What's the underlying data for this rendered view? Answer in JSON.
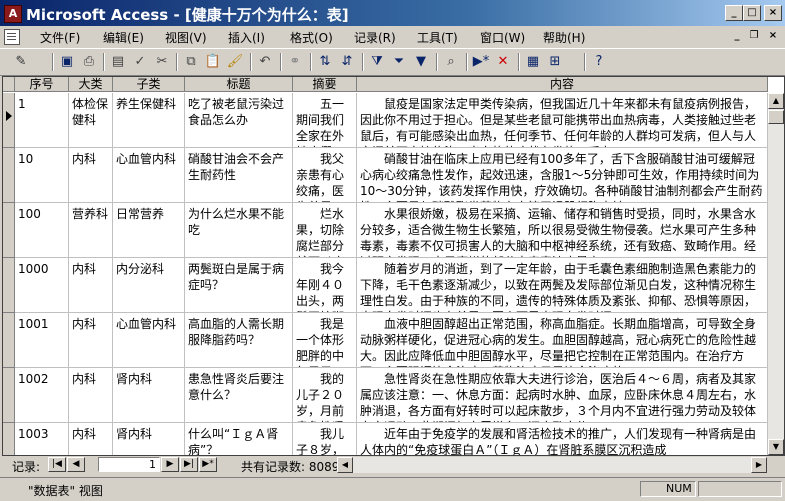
{
  "window": {
    "title": "Microsoft Access - [健康十万个为什么：表]",
    "app_icon": "access-key-icon"
  },
  "menu": {
    "items": [
      {
        "label": "文件(F)"
      },
      {
        "label": "编辑(E)"
      },
      {
        "label": "视图(V)"
      },
      {
        "label": "插入(I)"
      },
      {
        "label": "格式(O)"
      },
      {
        "label": "记录(R)"
      },
      {
        "label": "工具(T)"
      },
      {
        "label": "窗口(W)"
      },
      {
        "label": "帮助(H)"
      }
    ]
  },
  "toolbar": {
    "icons": [
      "design-view-icon",
      "save-icon",
      "print-preview-icon",
      "print-icon",
      "spell-check-icon",
      "cut-icon",
      "copy-icon",
      "paste-icon",
      "format-painter-icon",
      "undo-icon",
      "hyperlink-icon",
      "sort-ascending-icon",
      "sort-descending-icon",
      "filter-by-selection-icon",
      "filter-by-form-icon",
      "apply-filter-icon",
      "find-icon",
      "new-record-icon",
      "delete-record-icon",
      "database-window-icon",
      "new-object-icon",
      "help-icon"
    ]
  },
  "grid": {
    "columns": [
      "序号",
      "大类",
      "子类",
      "标题",
      "摘要",
      "内容"
    ],
    "rows": [
      {
        "id": "1",
        "category": "体检保健科",
        "subcategory": "养生保健科",
        "title": "吃了被老鼠污染过食品怎么办",
        "summary": "五一期间我们全家在外地度假，一个星期后回到自己的家，",
        "content": "鼠疫是国家法定甲类传染病，但我国近几十年来都未有鼠疫病例报告，因此你不用过于担心。但是某些老鼠可能携带出血热病毒，人类接触过些老鼠后，有可能感染出血热，任何季节、任何年龄的人群均可发病，但人与人之间并不直接传染。出血热的症状有发热、乏力"
      },
      {
        "id": "10",
        "category": "内科",
        "subcategory": "心血管内科",
        "title": "硝酸甘油会不会产生耐药性",
        "summary": "我父亲患有心绞痛，医生总是叮嘱他要随身携带硝酸甘油等",
        "content": "硝酸甘油在临床上应用已经有100多年了，舌下含服硝酸甘油可缓解冠心病心绞痛急性发作，起效迅速，含服1～5分钟即可生效，作用持续时间为10～30分钟，该药发挥作用快，疗效确切。各种硝酸甘油制剂都会产生耐药性，主要是与硝酸酯类药物在血管平滑肌细胞内转"
      },
      {
        "id": "100",
        "category": "营养科",
        "subcategory": "日常营养",
        "title": "为什么烂水果不能吃",
        "summary": "烂水果，切除腐烂部分就可以吃吗？我们家经常会扔掉",
        "content": "水果很娇嫩，极易在采摘、运输、储存和销售时受损，同时，水果含水分较多，适合微生物生长繁殖，所以很易受微生物侵袭。烂水果可产生多种毒素，毒素不仅可损害人的大脑和中枢神经系统，还有致癌、致畸作用。经过研究发现，水果腐烂的部分中毒素浓度最高"
      },
      {
        "id": "1000",
        "category": "内科",
        "subcategory": "内分泌科",
        "title": "两鬓斑白是属于病症吗？",
        "summary": "我今年刚４０出头，两鬓开始斑白。我总觉得我的年龄还",
        "content": "随着岁月的消逝，到了一定年龄，由于毛囊色素细胞制造黑色素能力的下降，毛干色素逐渐减少，以致在两鬓及发际部位渐见白发，这种情况称生理性白发。由于种族的不同，遗传的特殊体质及紊张、抑郁、恐惧等原因，出现白发时间也有差异：因人而异出现白发时间"
      },
      {
        "id": "1001",
        "category": "内科",
        "subcategory": "心血管内科",
        "title": "高血脂的人需长期服降脂药吗？",
        "summary": "我是一个体形肥胖的中年男子，体格检查中发现血脂偏高",
        "content": "血液中胆固醇超出正常范围，称高血脂症。长期血脂增高，可导致全身动脉粥样硬化，促进冠心病的发生。血胆固醇越高，冠心病死亡的危险性越大。因此应降低血中胆固醇水平，尽量把它控制在正常范围内。在治疗方面，主要强调饮食治疗，药物治疗只是饮食治疗的"
      },
      {
        "id": "1002",
        "category": "内科",
        "subcategory": "肾内科",
        "title": "患急性肾炎后要注意什么？",
        "summary": "我的儿子２０岁，月前患急性肾炎住院，问医生说好转，但",
        "content": "急性肾炎在急性期应依靠大夫进行诊治，医治后４～６周，病者及其家属应该注意：一、休息方面：起病时水肿、血尿，应卧床休息４周左右，水肿消退，各方面有好转时可以起床散步，３个月内不宜进行强力劳动及较体力之运动，此期间如血尿增多，还应卧床休"
      },
      {
        "id": "1003",
        "category": "内科",
        "subcategory": "肾内科",
        "title": "什么叫“ＩｇＡ肾病”？",
        "summary": "我儿子８岁，前些天患",
        "content": "近年由于免疫学的发展和肾活检技术的推广，人们发现有一种肾病是由人体内的“免疫球蛋白Ａ”（ＩｇＡ）在肾脏系膜区沉积造成"
      }
    ]
  },
  "navigation": {
    "label": "记录:",
    "current_record": "1",
    "total_label": "共有记录数: 8089"
  },
  "status": {
    "text": "\"数据表\" 视图",
    "num_lock": "NUM"
  }
}
